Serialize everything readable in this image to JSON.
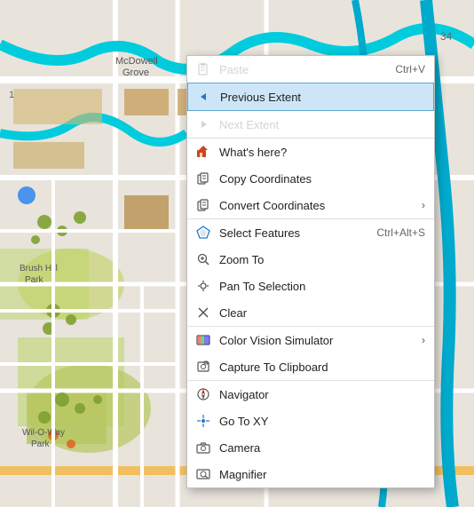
{
  "map": {
    "background_color": "#e8e0d8"
  },
  "context_menu": {
    "items": [
      {
        "id": "paste",
        "label": "Paste",
        "shortcut": "Ctrl+V",
        "icon": "📋",
        "icon_type": "paste",
        "disabled": true,
        "has_arrow": false,
        "separator_top": false
      },
      {
        "id": "previous-extent",
        "label": "Previous Extent",
        "shortcut": "",
        "icon": "←",
        "icon_type": "arrow-left",
        "disabled": false,
        "highlighted": true,
        "has_arrow": false,
        "separator_top": false
      },
      {
        "id": "next-extent",
        "label": "Next Extent",
        "shortcut": "",
        "icon": "→",
        "icon_type": "arrow-right",
        "disabled": true,
        "has_arrow": false,
        "separator_top": false
      },
      {
        "id": "whats-here",
        "label": "What's here?",
        "shortcut": "",
        "icon": "🏠",
        "icon_type": "house",
        "disabled": false,
        "has_arrow": false,
        "separator_top": true
      },
      {
        "id": "copy-coordinates",
        "label": "Copy Coordinates",
        "shortcut": "",
        "icon": "📐",
        "icon_type": "copy-coords",
        "disabled": false,
        "has_arrow": false,
        "separator_top": false
      },
      {
        "id": "convert-coordinates",
        "label": "Convert Coordinates",
        "shortcut": "",
        "icon": "📐",
        "icon_type": "convert-coords",
        "disabled": false,
        "has_arrow": true,
        "separator_top": false
      },
      {
        "id": "select-features",
        "label": "Select Features",
        "shortcut": "Ctrl+Alt+S",
        "icon": "⬡",
        "icon_type": "select",
        "disabled": false,
        "has_arrow": false,
        "separator_top": true
      },
      {
        "id": "zoom-to",
        "label": "Zoom To",
        "shortcut": "",
        "icon": "🔍",
        "icon_type": "zoom",
        "disabled": false,
        "has_arrow": false,
        "separator_top": false
      },
      {
        "id": "pan-to-selection",
        "label": "Pan To Selection",
        "shortcut": "",
        "icon": "🖐",
        "icon_type": "pan",
        "disabled": false,
        "has_arrow": false,
        "separator_top": false
      },
      {
        "id": "clear",
        "label": "Clear",
        "shortcut": "",
        "icon": "✕",
        "icon_type": "clear",
        "disabled": false,
        "has_arrow": false,
        "separator_top": false
      },
      {
        "id": "color-vision-simulator",
        "label": "Color Vision Simulator",
        "shortcut": "",
        "icon": "🎨",
        "icon_type": "color-vision",
        "disabled": false,
        "has_arrow": true,
        "separator_top": true
      },
      {
        "id": "capture-to-clipboard",
        "label": "Capture To Clipboard",
        "shortcut": "",
        "icon": "📷",
        "icon_type": "capture",
        "disabled": false,
        "has_arrow": false,
        "separator_top": false
      },
      {
        "id": "navigator",
        "label": "Navigator",
        "shortcut": "",
        "icon": "🧭",
        "icon_type": "navigator",
        "disabled": false,
        "has_arrow": false,
        "separator_top": true
      },
      {
        "id": "go-to-xy",
        "label": "Go To XY",
        "shortcut": "",
        "icon": "📍",
        "icon_type": "goto-xy",
        "disabled": false,
        "has_arrow": false,
        "separator_top": false
      },
      {
        "id": "camera",
        "label": "Camera",
        "shortcut": "",
        "icon": "📷",
        "icon_type": "camera",
        "disabled": false,
        "has_arrow": false,
        "separator_top": false
      },
      {
        "id": "magnifier",
        "label": "Magnifier",
        "shortcut": "",
        "icon": "🔎",
        "icon_type": "magnifier",
        "disabled": false,
        "has_arrow": false,
        "separator_top": false
      }
    ]
  }
}
